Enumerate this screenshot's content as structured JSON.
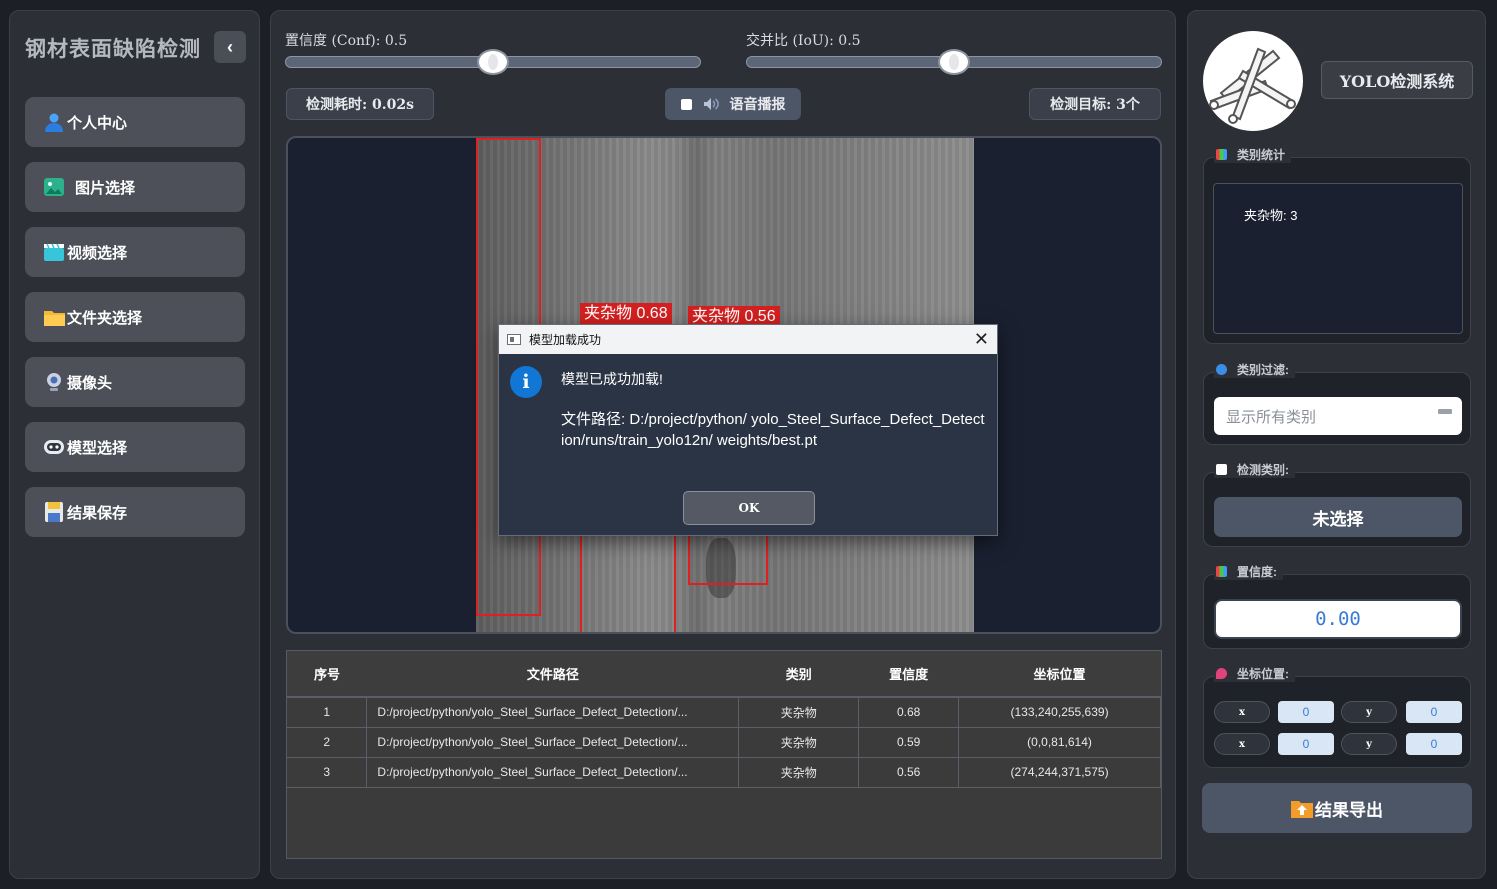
{
  "sidebar": {
    "title": "钢材表面缺陷检测",
    "collapse_glyph": "‹",
    "items": [
      {
        "label": "个人中心",
        "icon": "user-icon"
      },
      {
        "label": "图片选择",
        "icon": "image-icon"
      },
      {
        "label": "视频选择",
        "icon": "video-icon"
      },
      {
        "label": "文件夹选择",
        "icon": "folder-icon"
      },
      {
        "label": "摄像头",
        "icon": "camera-icon"
      },
      {
        "label": "模型选择",
        "icon": "model-icon"
      },
      {
        "label": "结果保存",
        "icon": "save-icon"
      }
    ]
  },
  "controls": {
    "conf_label": "置信度 (Conf): 0.5",
    "conf_value": 0.5,
    "iou_label": "交并比 (IoU): 0.5",
    "iou_value": 0.5,
    "time_label": "检测耗时: 0.02s",
    "voice_label": "语音播报",
    "target_label": "检测目标: 3个"
  },
  "detections": [
    {
      "label": "夹杂物 0.68"
    },
    {
      "label": "夹杂物 0.56"
    }
  ],
  "table": {
    "headers": [
      "序号",
      "文件路径",
      "类别",
      "置信度",
      "坐标位置"
    ],
    "rows": [
      [
        "1",
        "D:/project/python/yolo_Steel_Surface_Defect_Detection/...",
        "夹杂物",
        "0.68",
        "(133,240,255,639)"
      ],
      [
        "2",
        "D:/project/python/yolo_Steel_Surface_Defect_Detection/...",
        "夹杂物",
        "0.59",
        "(0,0,81,614)"
      ],
      [
        "3",
        "D:/project/python/yolo_Steel_Surface_Defect_Detection/...",
        "夹杂物",
        "0.56",
        "(274,244,371,575)"
      ]
    ]
  },
  "right": {
    "system_title": "YOLO检测系统",
    "stats_title": "类别统计",
    "stats_text": "夹杂物: 3",
    "filter_title": "类别过滤:",
    "filter_placeholder": "显示所有类别",
    "detect_title": "检测类别:",
    "detect_value": "未选择",
    "conf_title": "置信度:",
    "conf_value": "0.00",
    "coord_title": "坐标位置:",
    "coords": {
      "x_label": "x",
      "y_label": "y",
      "x1": "0",
      "y1": "0",
      "x2": "0",
      "y2": "0"
    },
    "export_label": "结果导出"
  },
  "dialog": {
    "title": "模型加载成功",
    "close": "✕",
    "info_glyph": "i",
    "message": "模型已成功加载!",
    "path": "文件路径: D:/project/python/ yolo_Steel_Surface_Defect_Detection/runs/train_yolo12n/ weights/best.pt",
    "ok_label": "OK"
  },
  "colors": {
    "accent_blue": "#3a7bd5",
    "box_red": "#e02020",
    "panel": "#2c2f35"
  }
}
